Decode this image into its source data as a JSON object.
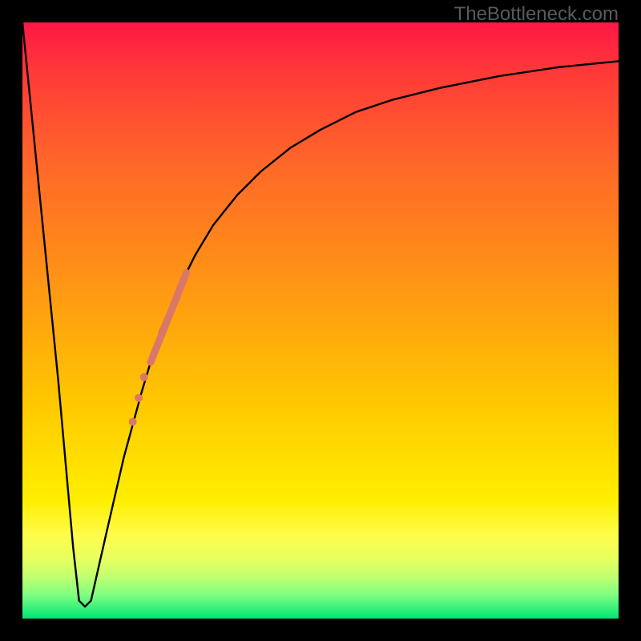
{
  "watermark": "TheBottleneck.com",
  "chart_data": {
    "type": "line",
    "title": "",
    "xlabel": "",
    "ylabel": "",
    "xlim": [
      0,
      100
    ],
    "ylim": [
      0,
      100
    ],
    "grid": false,
    "gradient": {
      "orientation": "vertical",
      "stops": [
        {
          "pos": 0,
          "color": "#ff1744"
        },
        {
          "pos": 50,
          "color": "#ffb000"
        },
        {
          "pos": 80,
          "color": "#ffee00"
        },
        {
          "pos": 100,
          "color": "#00e676"
        }
      ]
    },
    "series": [
      {
        "name": "curve",
        "color": "#000000",
        "width": 2.4,
        "x": [
          0,
          3,
          6,
          8.5,
          9.5,
          10.5,
          11.5,
          14,
          17,
          20,
          23,
          26,
          29,
          32,
          36,
          40,
          45,
          50,
          56,
          62,
          70,
          80,
          90,
          100
        ],
        "y": [
          100,
          70,
          40,
          12,
          3,
          2,
          3,
          14,
          27,
          38,
          48,
          55,
          61,
          66,
          71,
          75,
          79,
          82,
          85,
          87,
          89,
          91,
          92.5,
          93.5
        ]
      },
      {
        "name": "highlight-segment",
        "color": "#d97868",
        "width": 9,
        "x": [
          21.5,
          27.5
        ],
        "y": [
          43,
          58
        ]
      }
    ],
    "highlight_dots": {
      "color": "#d97868",
      "radius": 5,
      "points": [
        {
          "x": 20.4,
          "y": 40.5
        },
        {
          "x": 19.5,
          "y": 37
        },
        {
          "x": 18.5,
          "y": 33
        }
      ]
    }
  }
}
